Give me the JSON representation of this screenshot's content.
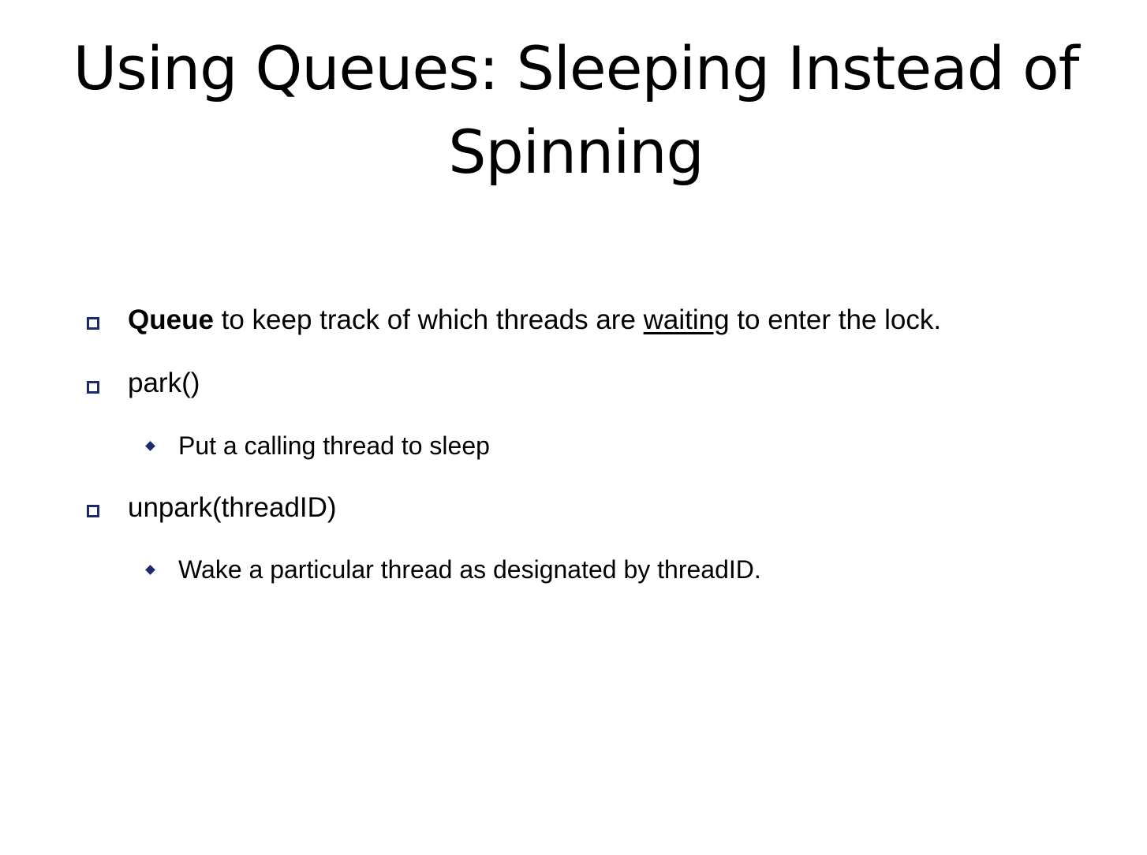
{
  "slide": {
    "title_line1": "Using Queues: Sleeping Instead of",
    "title_line2": "Spinning",
    "bullets": [
      {
        "bold": "Queue",
        "text_before_underline": " to keep track of which threads are ",
        "underline": "waiting",
        "text_after_underline": " to enter the lock."
      },
      {
        "text": "park()"
      },
      {
        "text": "Put a calling thread to sleep"
      },
      {
        "text": "unpark(threadID)"
      },
      {
        "text": "Wake a particular thread as designated by threadID."
      }
    ],
    "bullet_color": "#1a2a6c",
    "level1_marker_icon": "hollow-square-icon",
    "level2_marker_icon": "diamond-icon"
  }
}
